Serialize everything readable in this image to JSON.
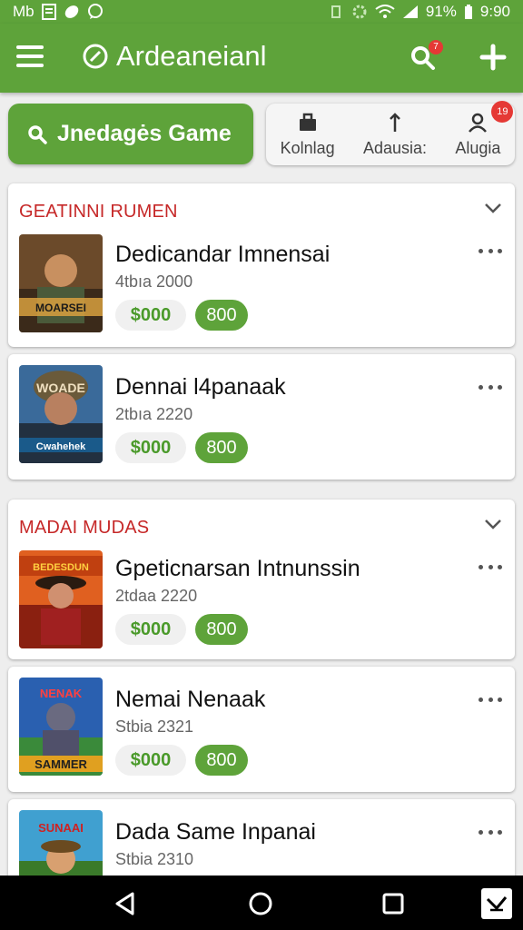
{
  "status_bar": {
    "carrier": "Mb",
    "battery": "91%",
    "time": "9:90"
  },
  "app_bar": {
    "title": "Ardeaneianl",
    "search_badge": "7"
  },
  "search": {
    "label": "Jnedagės Game"
  },
  "actions": [
    {
      "label": "Kolnlag",
      "icon": "briefcase-icon",
      "badge": ""
    },
    {
      "label": "Adausia:",
      "icon": "upload-arrow-icon",
      "badge": ""
    },
    {
      "label": "Alugia",
      "icon": "user-icon",
      "badge": "19"
    }
  ],
  "sections": [
    {
      "title": "GEATINNI RUMEN",
      "games": [
        {
          "title": "Dedicandar Imnensai",
          "subtitle": "4tbıa 2000",
          "price": "$000",
          "count": "800",
          "thumb_text": "MOARSEI"
        },
        {
          "title": "Dennai l4panaak",
          "subtitle": "2tbıa 2220",
          "price": "$000",
          "count": "800",
          "thumb_text": "WOADE"
        }
      ]
    },
    {
      "title": "MADAI MUDAS",
      "games": [
        {
          "title": "Gpeticnarsan Intnunssin",
          "subtitle": "2tdaa 2220",
          "price": "$000",
          "count": "800",
          "thumb_text": "BEDESDUN"
        },
        {
          "title": "Nemai Nenaak",
          "subtitle": "Stbia 2321",
          "price": "$000",
          "count": "800",
          "thumb_text": "SAMMER"
        },
        {
          "title": "Dada Same Inpanai",
          "subtitle": "Stbia 2310",
          "price": "",
          "count": "",
          "thumb_text": "SUNAAI"
        }
      ]
    }
  ],
  "colors": {
    "brand_green": "#5ea33a",
    "section_red": "#c62828",
    "price_green": "#4a9a2a"
  }
}
